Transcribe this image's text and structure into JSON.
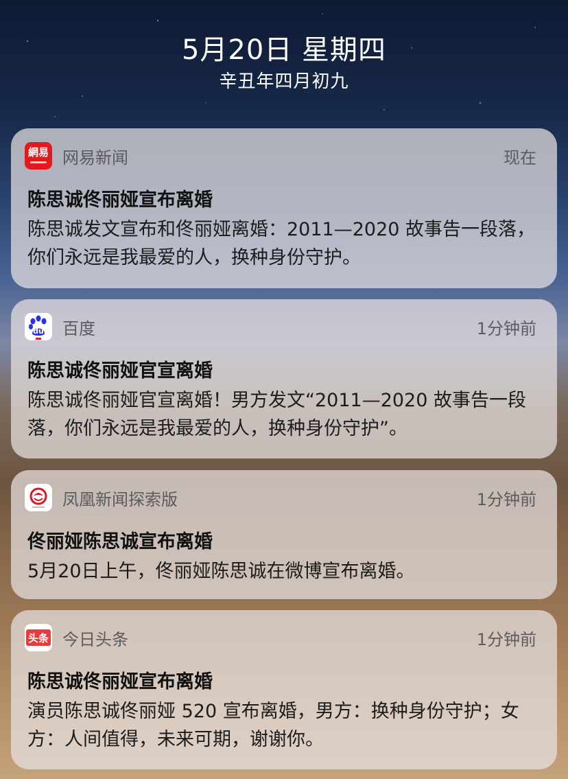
{
  "lockscreen": {
    "date": "5月20日 星期四",
    "lunar_date": "辛丑年四月初九"
  },
  "notifications": [
    {
      "app": "网易新闻",
      "icon": "netease-news-icon",
      "time": "现在",
      "title": "陈思诚佟丽娅宣布离婚",
      "body": "陈思诚发文宣布和佟丽娅离婚：2011—2020 故事告一段落，你们永远是我最爱的人，换种身份守护。"
    },
    {
      "app": "百度",
      "icon": "baidu-paw-icon",
      "time": "1分钟前",
      "title": "陈思诚佟丽娅官宣离婚",
      "body": "陈思诚佟丽娅官宣离婚！男方发文“2011—2020 故事告一段落，你们永远是我最爱的人，换种身份守护”。"
    },
    {
      "app": "凤凰新闻探索版",
      "icon": "ifeng-news-icon",
      "time": "1分钟前",
      "title": "佟丽娅陈思诚宣布离婚",
      "body": "5月20日上午，佟丽娅陈思诚在微博宣布离婚。"
    },
    {
      "app": "今日头条",
      "icon": "toutiao-icon",
      "time": "1分钟前",
      "title": "陈思诚佟丽娅宣布离婚",
      "body": "演员陈思诚佟丽娅 520 宣布离婚，男方：换种身份守护；女方：人间值得，未来可期，谢谢你。"
    }
  ],
  "icon_labels": {
    "netease": "網易",
    "baidu": "du",
    "toutiao": "头条"
  },
  "colors": {
    "netease_red": "#e3191e",
    "baidu_blue": "#2932e1",
    "ifeng_red": "#d8161e",
    "toutiao_red": "#e83b3b"
  }
}
